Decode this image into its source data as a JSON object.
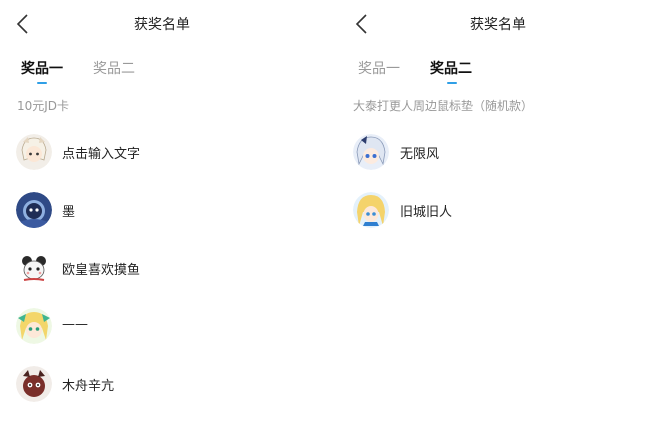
{
  "left": {
    "title": "获奖名单",
    "tabs": [
      {
        "label": "奖品一",
        "active": true
      },
      {
        "label": "奖品二",
        "active": false
      }
    ],
    "prize": "10元JD卡",
    "winners": [
      {
        "name": "点击输入文字",
        "avatar": "anime-girl-white-hair"
      },
      {
        "name": "墨",
        "avatar": "blue-robot"
      },
      {
        "name": "欧皇喜欢摸鱼",
        "avatar": "panda-character"
      },
      {
        "name": "——",
        "avatar": "anime-girl-green"
      },
      {
        "name": "木舟辛亢",
        "avatar": "red-creature"
      }
    ]
  },
  "right": {
    "title": "获奖名单",
    "tabs": [
      {
        "label": "奖品一",
        "active": false
      },
      {
        "label": "奖品二",
        "active": true
      }
    ],
    "prize": "大泰打更人周边鼠标垫（随机款）",
    "winners": [
      {
        "name": "无限风",
        "avatar": "anime-girl-blue-eyes"
      },
      {
        "name": "旧城旧人",
        "avatar": "anime-girl-blonde"
      }
    ]
  },
  "colors": {
    "accent": "#2f9fe6",
    "muted": "#999999"
  }
}
